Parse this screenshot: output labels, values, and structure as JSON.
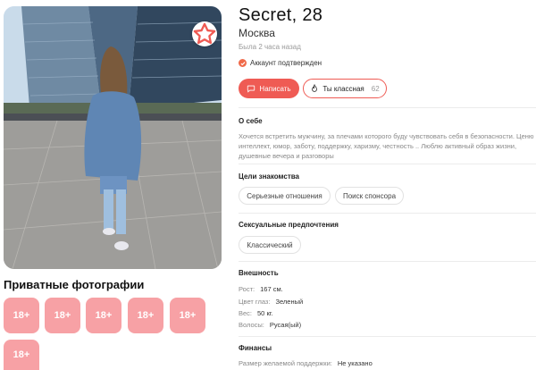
{
  "profile": {
    "name": "Secret, 28",
    "city": "Москва",
    "last_seen": "Была 2 часа назад",
    "verified_label": "Аккаунт подтвержден"
  },
  "actions": {
    "write_label": "Написать",
    "like_label": "Ты классная",
    "like_count": "62"
  },
  "about": {
    "title": "О себе",
    "text": "Хочется встретить мужчину, за плечами которого буду чувствовать себя в безопасности. Ценю интеллект, юмор, заботу, поддержку, харизму, честность .. Люблю активный образ жизни, душевные вечера и разговоры"
  },
  "goals": {
    "title": "Цели знакомства",
    "chips": [
      "Серьезные отношения",
      "Поиск спонсора"
    ]
  },
  "preferences": {
    "title": "Сексуальные предпочтения",
    "chips": [
      "Классический"
    ]
  },
  "appearance": {
    "title": "Внешность",
    "rows": [
      {
        "label": "Рост:",
        "value": "167 см."
      },
      {
        "label": "Цвет глаз:",
        "value": "Зеленый"
      },
      {
        "label": "Вес:",
        "value": "50 кг."
      },
      {
        "label": "Волосы:",
        "value": "Русая(ый)"
      }
    ]
  },
  "finance": {
    "title": "Финансы",
    "support_label": "Размер желаемой поддержки:",
    "support_value": "Не указано"
  },
  "private_photos": {
    "title": "Приватные фотографии",
    "tiles": [
      "18+",
      "18+",
      "18+",
      "18+",
      "18+",
      "18+"
    ]
  },
  "icons": {
    "favorite": "star-icon",
    "write": "chat-bubble-icon",
    "like": "flame-icon",
    "verified": "check-icon"
  },
  "colors": {
    "accent": "#ef5b54",
    "tile": "#f7a1a5",
    "verified": "#f06a4a"
  }
}
